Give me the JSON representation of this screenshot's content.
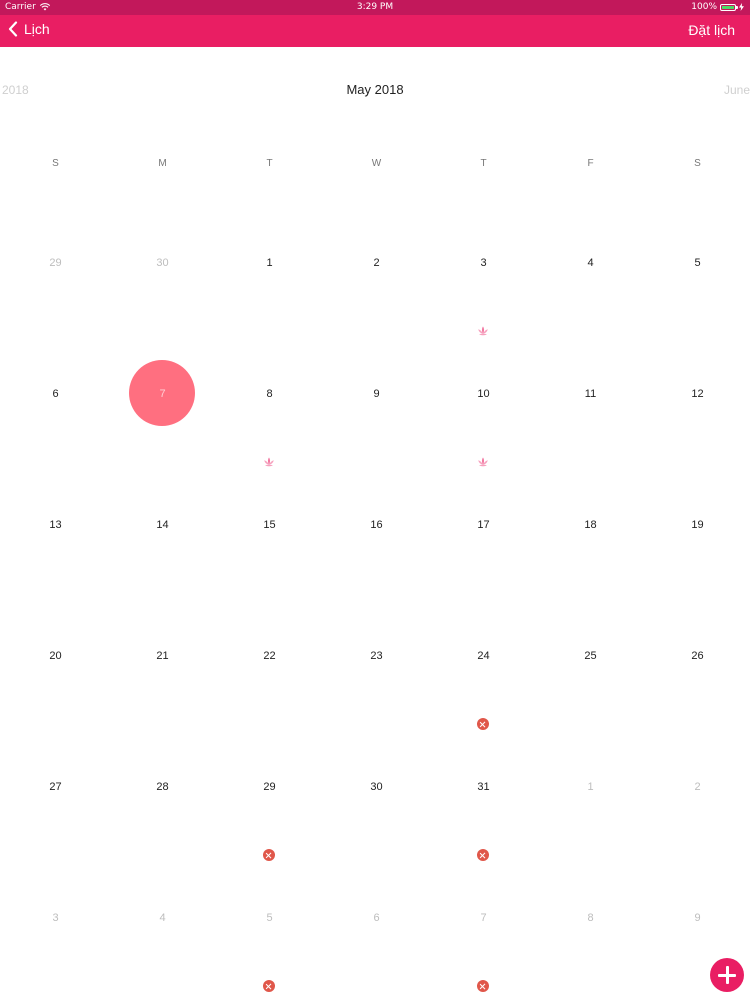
{
  "status_bar": {
    "carrier": "Carrier",
    "time": "3:29 PM",
    "battery": "100%",
    "battery_level": 1.0,
    "icons": [
      "wifi-icon",
      "battery-icon",
      "charging-icon"
    ]
  },
  "nav": {
    "back_label": "Lịch",
    "back_icon": "chevron-left-icon",
    "action_label": "Đặt lịch"
  },
  "month": {
    "prev_label": "2018",
    "title": "May 2018",
    "next_label": "June"
  },
  "weekdays": [
    "S",
    "M",
    "T",
    "W",
    "T",
    "F",
    "S"
  ],
  "calendar": {
    "days": [
      {
        "label": "29",
        "muted": true
      },
      {
        "label": "30",
        "muted": true
      },
      {
        "label": "1"
      },
      {
        "label": "2"
      },
      {
        "label": "3",
        "marker": "lotus-icon"
      },
      {
        "label": "4"
      },
      {
        "label": "5"
      },
      {
        "label": "6"
      },
      {
        "label": "7",
        "selected": true
      },
      {
        "label": "8",
        "marker": "lotus-icon"
      },
      {
        "label": "9"
      },
      {
        "label": "10",
        "marker": "lotus-icon"
      },
      {
        "label": "11"
      },
      {
        "label": "12"
      },
      {
        "label": "13"
      },
      {
        "label": "14"
      },
      {
        "label": "15"
      },
      {
        "label": "16"
      },
      {
        "label": "17"
      },
      {
        "label": "18"
      },
      {
        "label": "19"
      },
      {
        "label": "20"
      },
      {
        "label": "21"
      },
      {
        "label": "22"
      },
      {
        "label": "23"
      },
      {
        "label": "24",
        "marker": "cancel-icon"
      },
      {
        "label": "25"
      },
      {
        "label": "26"
      },
      {
        "label": "27"
      },
      {
        "label": "28"
      },
      {
        "label": "29",
        "marker": "cancel-icon"
      },
      {
        "label": "30"
      },
      {
        "label": "31",
        "marker": "cancel-icon"
      },
      {
        "label": "1",
        "muted": true
      },
      {
        "label": "2",
        "muted": true
      },
      {
        "label": "3",
        "muted": true
      },
      {
        "label": "4",
        "muted": true
      },
      {
        "label": "5",
        "muted": true,
        "marker": "cancel-icon"
      },
      {
        "label": "6",
        "muted": true
      },
      {
        "label": "7",
        "muted": true,
        "marker": "cancel-icon"
      },
      {
        "label": "8",
        "muted": true
      },
      {
        "label": "9",
        "muted": true
      }
    ]
  },
  "fab": {
    "icon": "plus-icon"
  },
  "colors": {
    "status_bar": "#c2185b",
    "nav_bar": "#e91e63",
    "selected_day": "#ff6f80",
    "cancel_marker": "#e0574a",
    "lotus_marker": "#f06292",
    "muted_text": "#bdbdbd"
  }
}
